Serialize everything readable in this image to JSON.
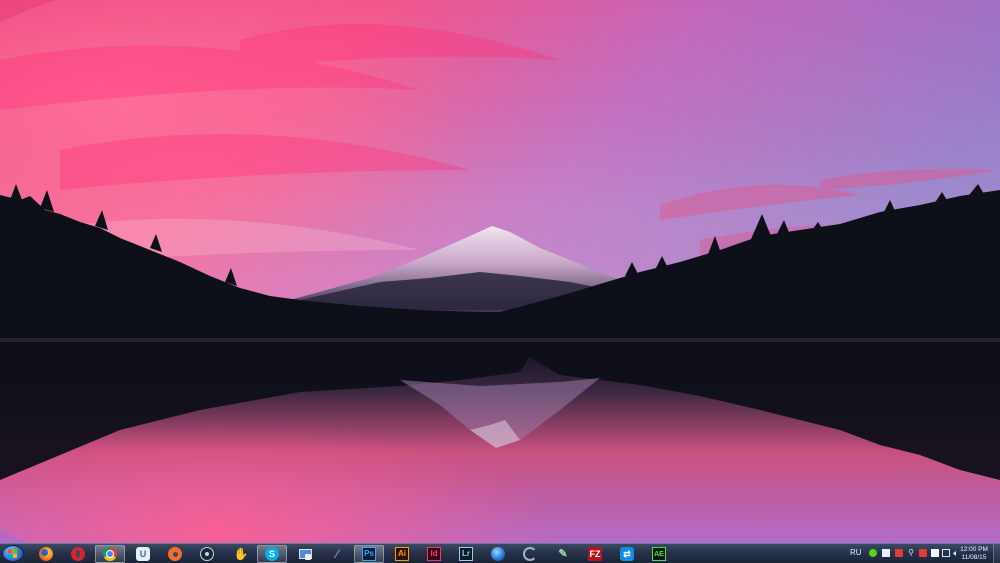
{
  "desktop": {
    "wallpaper": "mountain-lake-sunset"
  },
  "taskbar": {
    "start_button": {
      "icon": "windows-logo-icon"
    },
    "apps": [
      {
        "id": "firefox",
        "icon": "firefox-icon"
      },
      {
        "id": "opera",
        "icon": "opera-icon"
      },
      {
        "id": "chrome",
        "icon": "chrome-icon",
        "active": true
      },
      {
        "id": "uplay",
        "icon": "uplay-icon",
        "glyph": "U"
      },
      {
        "id": "origin",
        "icon": "origin-icon"
      },
      {
        "id": "steam",
        "icon": "steam-icon"
      },
      {
        "id": "hand-app",
        "icon": "hand-icon",
        "glyph": "✋"
      },
      {
        "id": "skype",
        "icon": "skype-icon",
        "glyph": "S",
        "active": true
      },
      {
        "id": "computer",
        "icon": "computer-icon"
      },
      {
        "id": "feather-app",
        "icon": "feather-icon",
        "glyph": "⁄"
      },
      {
        "id": "photoshop",
        "icon": "photoshop-icon",
        "glyph": "Ps",
        "active": true
      },
      {
        "id": "illustrator",
        "icon": "illustrator-icon",
        "glyph": "Ai"
      },
      {
        "id": "indesign",
        "icon": "indesign-icon",
        "glyph": "Id"
      },
      {
        "id": "lightroom",
        "icon": "lightroom-icon",
        "glyph": "Lr"
      },
      {
        "id": "globe-app",
        "icon": "globe-icon"
      },
      {
        "id": "swirl-app",
        "icon": "swirl-icon"
      },
      {
        "id": "pen-app",
        "icon": "pen-icon",
        "glyph": "✎"
      },
      {
        "id": "filezilla",
        "icon": "filezilla-icon",
        "glyph": "FZ"
      },
      {
        "id": "teamviewer",
        "icon": "teamviewer-icon",
        "glyph": "⇄"
      },
      {
        "id": "matrix-app",
        "icon": "matrix-icon",
        "glyph": "AE"
      }
    ],
    "tray": {
      "language": "RU",
      "clock_time": "12:00 PM",
      "clock_date": "11/08/15"
    }
  }
}
